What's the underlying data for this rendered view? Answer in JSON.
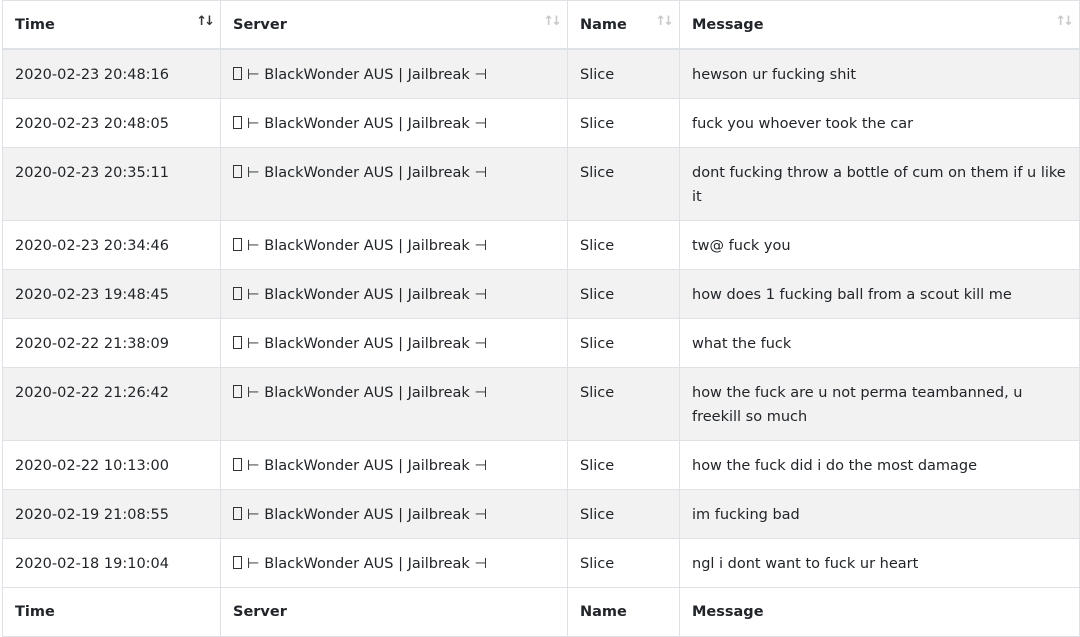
{
  "columns": [
    "Time",
    "Server",
    "Name",
    "Message"
  ],
  "sort_icon": "↑↓",
  "server_prefix": "⊢",
  "server_suffix": "⊣",
  "rows": [
    {
      "time": "2020-02-23 20:48:16",
      "server": "BlackWonder AUS | Jailbreak",
      "name": "Slice",
      "message": "hewson ur fucking shit"
    },
    {
      "time": "2020-02-23 20:48:05",
      "server": "BlackWonder AUS | Jailbreak",
      "name": "Slice",
      "message": "fuck you whoever took the car"
    },
    {
      "time": "2020-02-23 20:35:11",
      "server": "BlackWonder AUS | Jailbreak",
      "name": "Slice",
      "message": "dont fucking throw a bottle of cum on them if u like it"
    },
    {
      "time": "2020-02-23 20:34:46",
      "server": "BlackWonder AUS | Jailbreak",
      "name": "Slice",
      "message": "tw@ fuck you"
    },
    {
      "time": "2020-02-23 19:48:45",
      "server": "BlackWonder AUS | Jailbreak",
      "name": "Slice",
      "message": "how does 1 fucking ball from a scout kill me"
    },
    {
      "time": "2020-02-22 21:38:09",
      "server": "BlackWonder AUS | Jailbreak",
      "name": "Slice",
      "message": "what the fuck"
    },
    {
      "time": "2020-02-22 21:26:42",
      "server": "BlackWonder AUS | Jailbreak",
      "name": "Slice",
      "message": "how the fuck are u not perma teambanned, u freekill so much"
    },
    {
      "time": "2020-02-22 10:13:00",
      "server": "BlackWonder AUS | Jailbreak",
      "name": "Slice",
      "message": "how the fuck did i do the most damage"
    },
    {
      "time": "2020-02-19 21:08:55",
      "server": "BlackWonder AUS | Jailbreak",
      "name": "Slice",
      "message": "im fucking bad"
    },
    {
      "time": "2020-02-18 19:10:04",
      "server": "BlackWonder AUS | Jailbreak",
      "name": "Slice",
      "message": "ngl i dont want to fuck ur heart"
    }
  ]
}
